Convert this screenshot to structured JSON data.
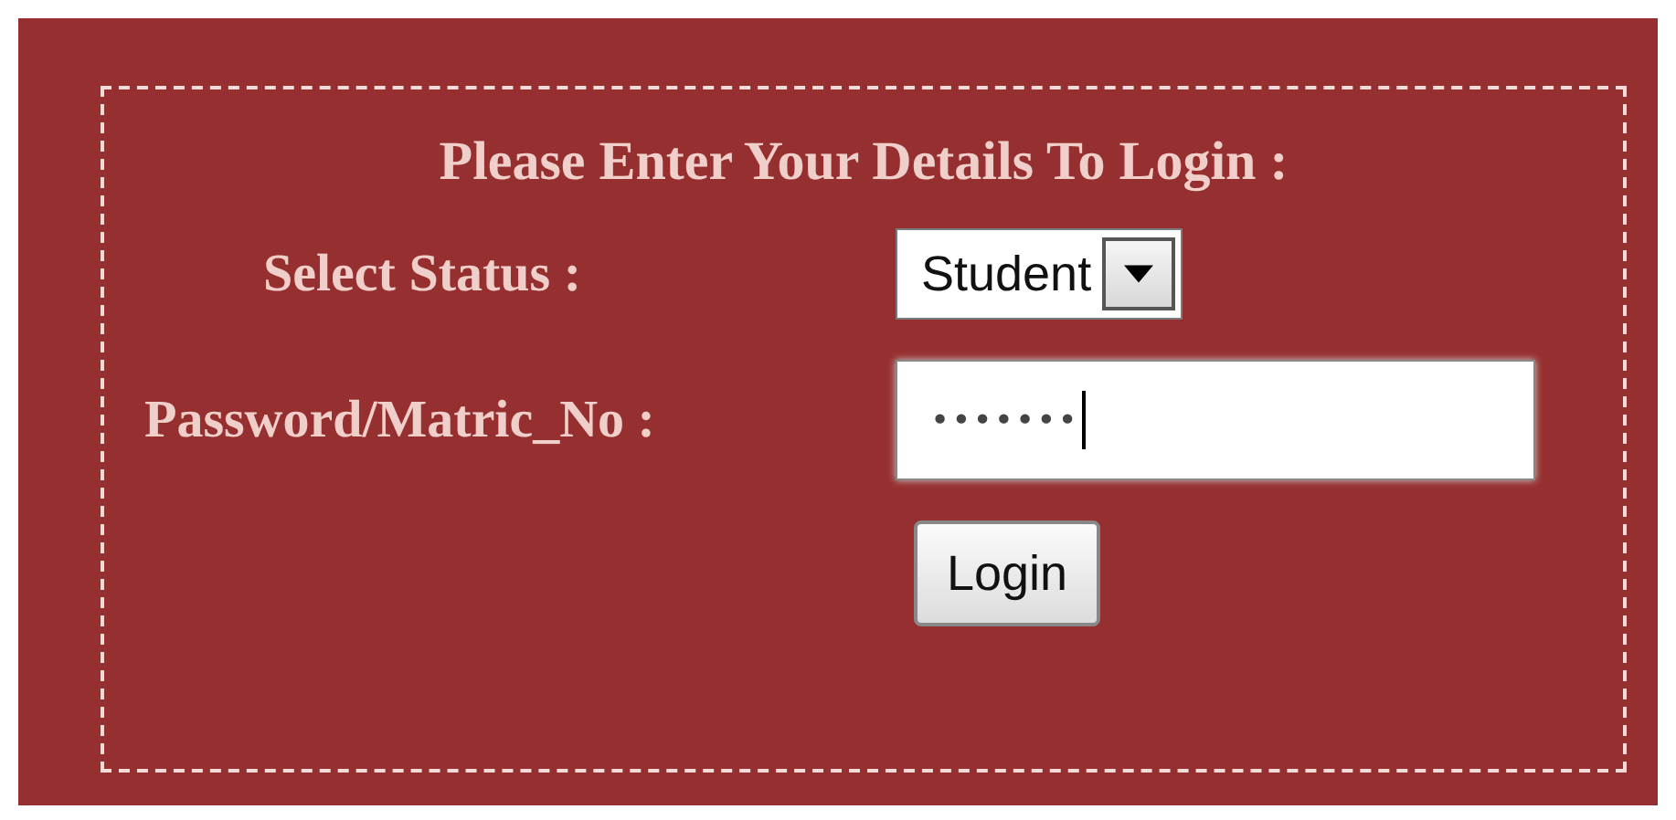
{
  "form": {
    "title": "Please Enter Your Details To Login :",
    "status": {
      "label": "Select Status :",
      "value": "Student"
    },
    "password": {
      "label": "Password/Matric_No :",
      "value": "•••••••",
      "focused": true
    },
    "button": "Login"
  }
}
